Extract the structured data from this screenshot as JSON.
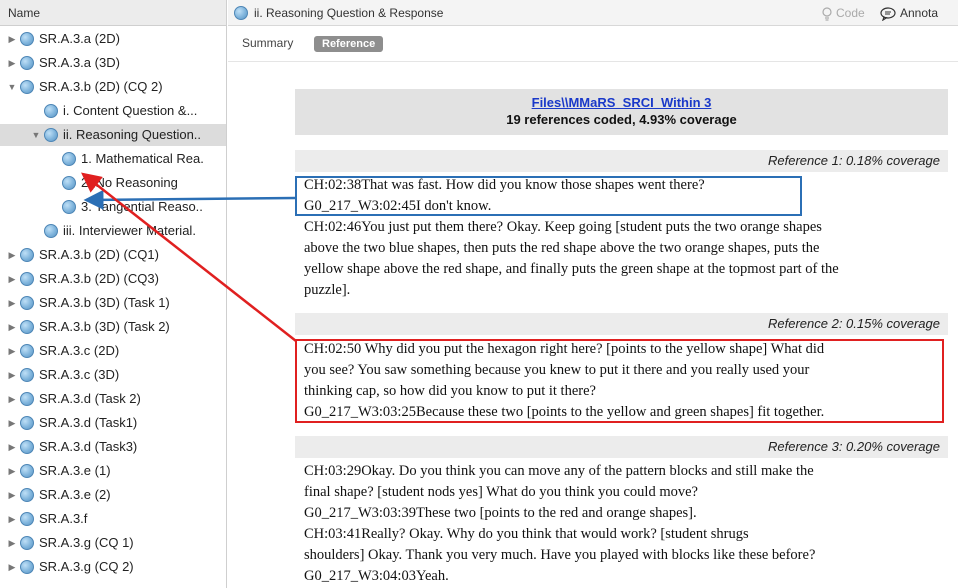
{
  "left_panel": {
    "header": "Name",
    "items": [
      {
        "label": "SR.A.3.a (2D)",
        "disclosure": "▶",
        "level": 0,
        "selected": false
      },
      {
        "label": "SR.A.3.a (3D)",
        "disclosure": "▶",
        "level": 0,
        "selected": false
      },
      {
        "label": "SR.A.3.b (2D) (CQ 2)",
        "disclosure": "▼",
        "level": 0,
        "selected": false
      },
      {
        "label": "i. Content Question &...",
        "disclosure": "",
        "level": 1,
        "selected": false
      },
      {
        "label": "ii. Reasoning Question..",
        "disclosure": "▼",
        "level": 1,
        "selected": true
      },
      {
        "label": "1. Mathematical Rea.",
        "disclosure": "",
        "level": 2,
        "selected": false
      },
      {
        "label": "2. No Reasoning",
        "disclosure": "",
        "level": 2,
        "selected": false
      },
      {
        "label": "3. Tangential Reaso..",
        "disclosure": "",
        "level": 2,
        "selected": false
      },
      {
        "label": "iii. Interviewer Material.",
        "disclosure": "",
        "level": 1,
        "selected": false
      },
      {
        "label": "SR.A.3.b (2D) (CQ1)",
        "disclosure": "▶",
        "level": 0,
        "selected": false
      },
      {
        "label": "SR.A.3.b (2D) (CQ3)",
        "disclosure": "▶",
        "level": 0,
        "selected": false
      },
      {
        "label": "SR.A.3.b (3D) (Task 1)",
        "disclosure": "▶",
        "level": 0,
        "selected": false
      },
      {
        "label": "SR.A.3.b (3D) (Task 2)",
        "disclosure": "▶",
        "level": 0,
        "selected": false
      },
      {
        "label": "SR.A.3.c (2D)",
        "disclosure": "▶",
        "level": 0,
        "selected": false
      },
      {
        "label": "SR.A.3.c (3D)",
        "disclosure": "▶",
        "level": 0,
        "selected": false
      },
      {
        "label": "SR.A.3.d (Task 2)",
        "disclosure": "▶",
        "level": 0,
        "selected": false
      },
      {
        "label": "SR.A.3.d (Task1)",
        "disclosure": "▶",
        "level": 0,
        "selected": false
      },
      {
        "label": "SR.A.3.d (Task3)",
        "disclosure": "▶",
        "level": 0,
        "selected": false
      },
      {
        "label": "SR.A.3.e (1)",
        "disclosure": "▶",
        "level": 0,
        "selected": false
      },
      {
        "label": "SR.A.3.e (2)",
        "disclosure": "▶",
        "level": 0,
        "selected": false
      },
      {
        "label": "SR.A.3.f",
        "disclosure": "▶",
        "level": 0,
        "selected": false
      },
      {
        "label": "SR.A.3.g (CQ 1)",
        "disclosure": "▶",
        "level": 0,
        "selected": false
      },
      {
        "label": "SR.A.3.g (CQ 2)",
        "disclosure": "▶",
        "level": 0,
        "selected": false
      }
    ]
  },
  "title_bar": {
    "title": "ii. Reasoning Question & Response",
    "code_label": "Code",
    "annotate_label": "Annota"
  },
  "tabs": {
    "summary": "Summary",
    "reference": "Reference"
  },
  "file_header": {
    "link": "Files\\\\MMaRS_SRCI_Within 3",
    "summary": "19 references coded, 4.93% coverage"
  },
  "references": [
    {
      "header": "Reference 1: 0.18% coverage",
      "lines": [
        "CH:02:38That was fast. How did you know those shapes went there?",
        "G0_217_W3:02:45I don't know.",
        "CH:02:46You just put them there? Okay. Keep going [student puts the two orange shapes",
        "above the two blue shapes, then puts the red shape above the two orange shapes, puts the",
        "yellow shape above the red shape, and finally puts the green shape at the topmost part of the",
        "puzzle]."
      ]
    },
    {
      "header": "Reference 2: 0.15% coverage",
      "lines": [
        "CH:02:50 Why did you put the hexagon right here? [points to the yellow shape] What did",
        "you see? You saw something because you knew to put it there and you really used your",
        "thinking cap, so how did you know to put it there?",
        "G0_217_W3:03:25Because these two [points to the yellow and green shapes] fit together."
      ]
    },
    {
      "header": "Reference 3: 0.20% coverage",
      "lines": [
        "CH:03:29Okay. Do you think you can move any of the pattern blocks and still make the",
        "final shape? [student nods yes] What do you think you could move?",
        "G0_217_W3:03:39These two [points to the red and orange shapes].",
        "CH:03:41Really? Okay. Why do you think that would work? [student shrugs",
        "shoulders] Okay. Thank you very much. Have you played with blocks like these before?",
        "G0_217_W3:04:03Yeah."
      ]
    }
  ],
  "colors": {
    "blue_box": "#2b6fb5",
    "red_box": "#e02020",
    "link": "#1a39c9"
  }
}
